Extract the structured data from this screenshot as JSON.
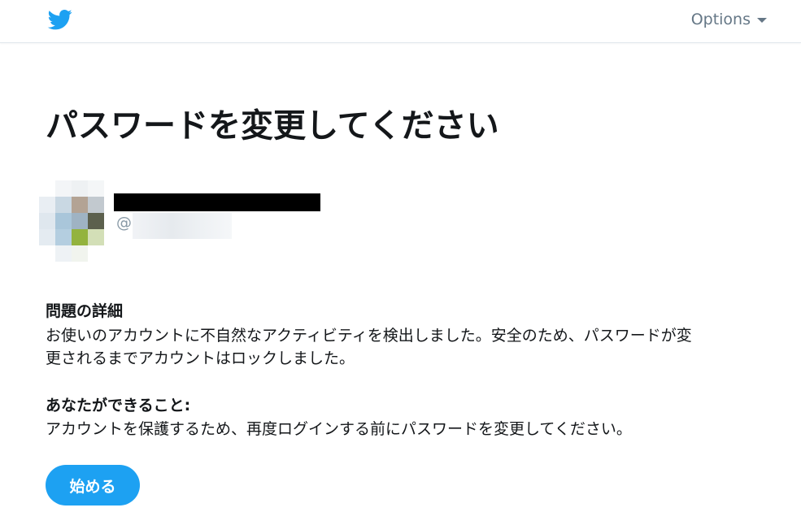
{
  "header": {
    "logo_icon": "twitter-bird-icon",
    "options_label": "Options"
  },
  "page": {
    "title": "パスワードを変更してください"
  },
  "account": {
    "display_name_redacted": true,
    "handle_prefix": "@"
  },
  "details": {
    "heading": "問題の詳細",
    "body_line1": "お使いのアカウントに不自然なアクティビティを検出しました。安全のため、パスワードが変",
    "body_line2": "更されるまでアカウントはロックしました。"
  },
  "actions": {
    "heading": "あなたができること:",
    "body": "アカウントを保護するため、再度ログインする前にパスワードを変更してください。"
  },
  "buttons": {
    "start_label": "始める"
  },
  "colors": {
    "brand": "#1da1f2",
    "text": "#14171a",
    "muted": "#657786"
  }
}
